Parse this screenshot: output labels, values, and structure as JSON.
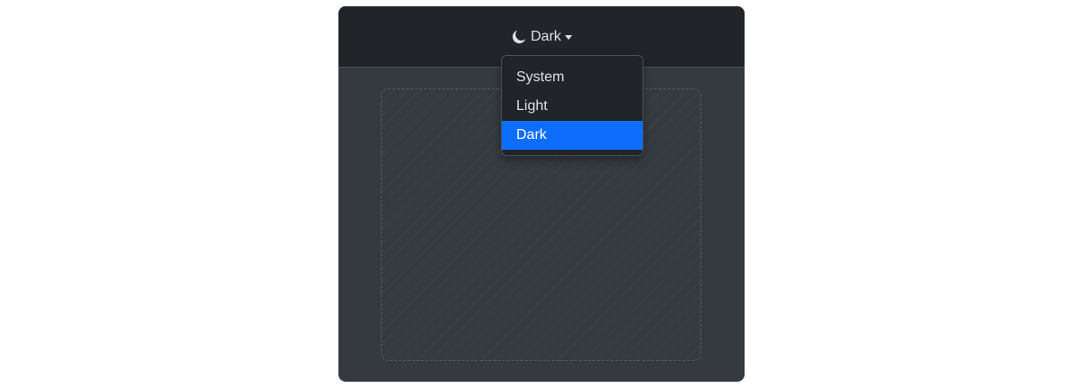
{
  "header": {
    "theme_toggle": {
      "icon": "moon-icon",
      "label": "Dark",
      "caret": "caret-down-icon"
    }
  },
  "theme_menu": {
    "items": [
      {
        "label": "System",
        "selected": false
      },
      {
        "label": "Light",
        "selected": false
      },
      {
        "label": "Dark",
        "selected": true
      }
    ]
  },
  "colors": {
    "header_bg": "#212529",
    "body_bg": "#343a40",
    "text": "#dee2e6",
    "accent": "#0d6efd"
  }
}
